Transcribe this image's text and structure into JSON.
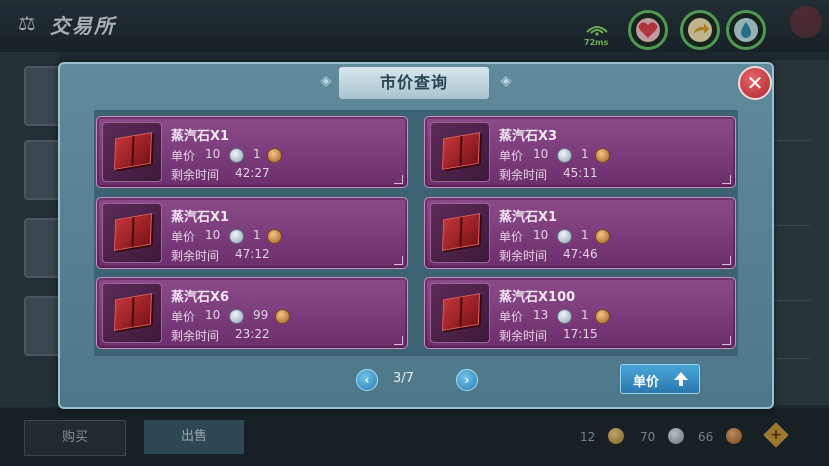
{
  "background": {
    "title": "交易所",
    "ping": "72ms",
    "buy_label": "购买",
    "sell_label": "出售",
    "currency": {
      "gold": "12",
      "silver": "70",
      "copper": "66"
    }
  },
  "dialog": {
    "title": "市价查询",
    "close_symbol": "✕",
    "price_label": "单价",
    "time_label": "剩余时间",
    "listings": [
      {
        "name": "蒸汽石X1",
        "price_silver": "10",
        "price_copper": "1",
        "time": "42:27"
      },
      {
        "name": "蒸汽石X3",
        "price_silver": "10",
        "price_copper": "1",
        "time": "45:11"
      },
      {
        "name": "蒸汽石X1",
        "price_silver": "10",
        "price_copper": "1",
        "time": "47:12"
      },
      {
        "name": "蒸汽石X1",
        "price_silver": "10",
        "price_copper": "1",
        "time": "47:46"
      },
      {
        "name": "蒸汽石X6",
        "price_silver": "10",
        "price_copper": "99",
        "time": "23:22"
      },
      {
        "name": "蒸汽石X100",
        "price_silver": "13",
        "price_copper": "1",
        "time": "17:15"
      }
    ],
    "pagination": {
      "page": "3/7",
      "prev_symbol": "‹",
      "next_symbol": "›"
    },
    "sort_button": "单价"
  },
  "colors": {
    "card_bg": "#7a3a79",
    "panel_bg": "#5f8a9a",
    "accent_blue": "#2a78ad",
    "close_red": "#b0262f"
  },
  "icons": [
    "scale-icon",
    "wifi-icon",
    "heart-icon",
    "share-icon",
    "drop-icon",
    "close-icon",
    "steam-stone-icon",
    "silver-coin-icon",
    "copper-coin-icon",
    "prev-arrow-icon",
    "next-arrow-icon",
    "sort-arrow-icon",
    "plus-icon"
  ]
}
